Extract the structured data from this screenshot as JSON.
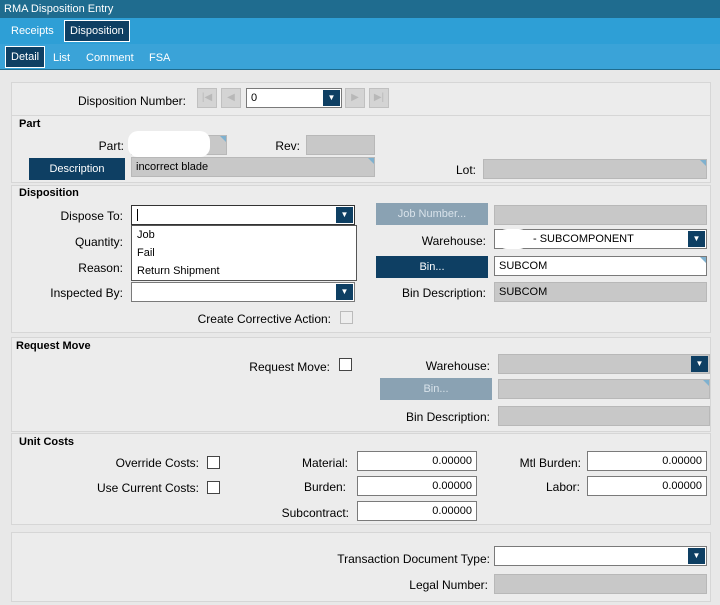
{
  "window": {
    "title": "RMA Disposition Entry"
  },
  "top_tabs": [
    {
      "label": "Receipts"
    },
    {
      "label": "Disposition"
    }
  ],
  "sub_tabs": [
    {
      "label": "Detail"
    },
    {
      "label": "List"
    },
    {
      "label": "Comment"
    },
    {
      "label": "FSA"
    }
  ],
  "header": {
    "disposition_number_label": "Disposition Number:",
    "disposition_number_value": "0"
  },
  "part": {
    "section_title": "Part",
    "part_label": "Part:",
    "rev_label": "Rev:",
    "description_button": "Description",
    "description_value": "incorrect blade",
    "lot_label": "Lot:"
  },
  "disposition": {
    "section_title": "Disposition",
    "dispose_to_label": "Dispose To:",
    "dispose_to_value": "",
    "dispose_options": [
      "Job",
      "Fail",
      "Return Shipment"
    ],
    "quantity_label": "Quantity:",
    "reason_label": "Reason:",
    "inspected_by_label": "Inspected By:",
    "corrective_action_label": "Create Corrective Action:",
    "job_number_button": "Job Number...",
    "warehouse_label": "Warehouse:",
    "warehouse_value": "- SUBCOMPONENT",
    "bin_button": "Bin...",
    "bin_value": "SUBCOM",
    "bin_description_label": "Bin Description:",
    "bin_description_value": "SUBCOM"
  },
  "request_move": {
    "section_title": "Request Move",
    "request_move_label": "Request Move:",
    "warehouse_label": "Warehouse:",
    "bin_button": "Bin...",
    "bin_description_label": "Bin Description:"
  },
  "unit_costs": {
    "section_title": "Unit Costs",
    "override_costs_label": "Override Costs:",
    "use_current_costs_label": "Use Current Costs:",
    "material_label": "Material:",
    "material_value": "0.00000",
    "burden_label": "Burden:",
    "burden_value": "0.00000",
    "subcontract_label": "Subcontract:",
    "subcontract_value": "0.00000",
    "mtl_burden_label": "Mtl Burden:",
    "mtl_burden_value": "0.00000",
    "labor_label": "Labor:",
    "labor_value": "0.00000"
  },
  "footer": {
    "transaction_doc_type_label": "Transaction Document Type:",
    "legal_number_label": "Legal Number:"
  }
}
